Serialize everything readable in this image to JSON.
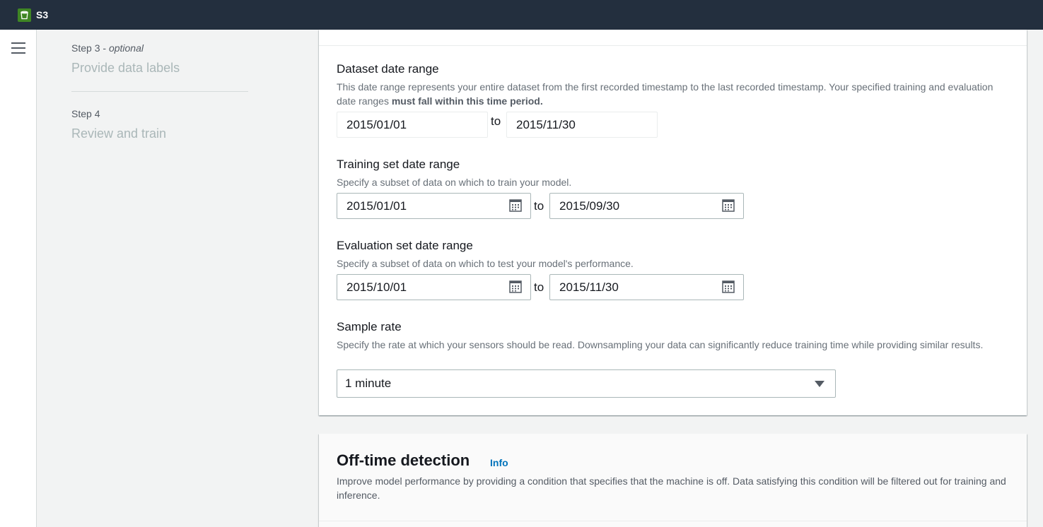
{
  "topbar": {
    "service_name": "S3",
    "service_icon": "s3-bucket-icon"
  },
  "nav": {
    "step3_number": "Step 3",
    "step3_sep": " - ",
    "step3_optional": "optional",
    "step3_title": "Provide data labels",
    "step4_number": "Step 4",
    "step4_title": "Review and train"
  },
  "dataset_range": {
    "label": "Dataset date range",
    "desc": "This date range represents your entire dataset from the first recorded timestamp to the last recorded timestamp. Your specified training and evaluation date ranges ",
    "desc_bold": "must fall within this time period.",
    "start": "2015/01/01",
    "to": "to",
    "end": "2015/11/30"
  },
  "training_range": {
    "label": "Training set date range",
    "desc": "Specify a subset of data on which to train your model.",
    "start": "2015/01/01",
    "to": "to",
    "end": "2015/09/30"
  },
  "evaluation_range": {
    "label": "Evaluation set date range",
    "desc": "Specify a subset of data on which to test your model's performance.",
    "start": "2015/10/01",
    "to": "to",
    "end": "2015/11/30"
  },
  "sample_rate": {
    "label": "Sample rate",
    "desc": "Specify the rate at which your sensors should be read. Downsampling your data can significantly reduce training time while providing similar results.",
    "value": "1 minute"
  },
  "offtime": {
    "title": "Off-time detection",
    "info": "Info",
    "desc": "Improve model performance by providing a condition that specifies that the machine is off. Data satisfying this condition will be filtered out for training and inference."
  },
  "colors": {
    "topbar": "#232f3e",
    "service_icon": "#3f8624",
    "link": "#0073bb",
    "disabled_step": "#aab7b8"
  }
}
